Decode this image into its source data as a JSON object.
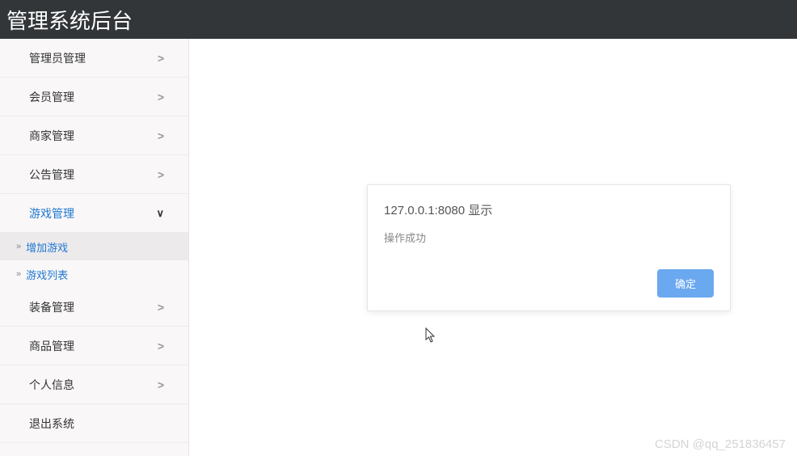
{
  "header": {
    "title": "管理系统后台"
  },
  "sidebar": {
    "items": [
      {
        "label": "管理员管理",
        "expanded": false
      },
      {
        "label": "会员管理",
        "expanded": false
      },
      {
        "label": "商家管理",
        "expanded": false
      },
      {
        "label": "公告管理",
        "expanded": false
      },
      {
        "label": "游戏管理",
        "expanded": true,
        "children": [
          {
            "label": "增加游戏",
            "active": true
          },
          {
            "label": "游戏列表",
            "active": false
          }
        ]
      },
      {
        "label": "装备管理",
        "expanded": false
      },
      {
        "label": "商品管理",
        "expanded": false
      },
      {
        "label": "个人信息",
        "expanded": false
      },
      {
        "label": "退出系统",
        "expanded": false
      }
    ]
  },
  "dialog": {
    "title": "127.0.0.1:8080 显示",
    "message": "操作成功",
    "confirm_label": "确定"
  },
  "watermark": "CSDN @qq_251836457"
}
